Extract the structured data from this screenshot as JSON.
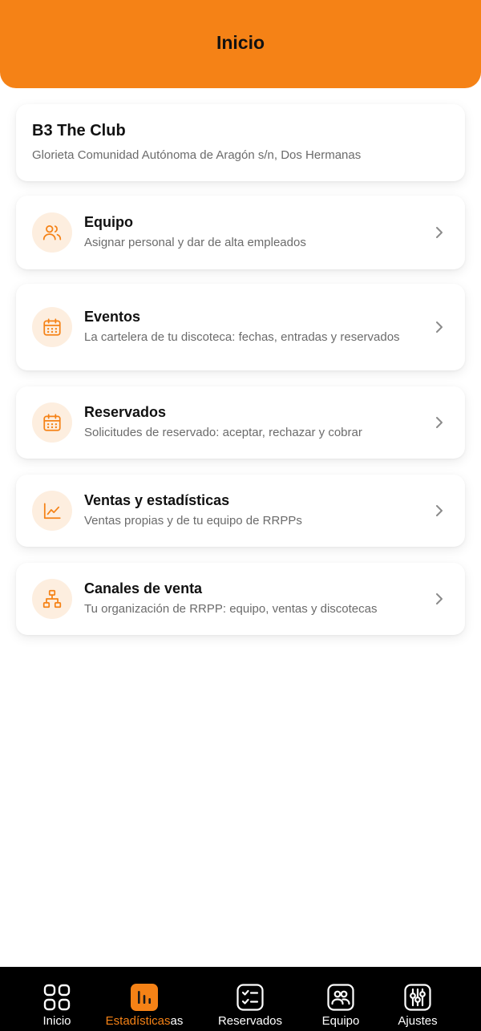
{
  "header": {
    "title": "Inicio"
  },
  "club": {
    "name": "B3 The Club",
    "address": "Glorieta Comunidad Autónoma de Aragón s/n, Dos Hermanas"
  },
  "menu": [
    {
      "title": "Equipo",
      "description": "Asignar personal y dar de alta empleados",
      "icon": "users-icon"
    },
    {
      "title": "Eventos",
      "description": "La cartelera de tu discoteca: fechas, entradas y reservados",
      "icon": "calendar-icon"
    },
    {
      "title": "Reservados",
      "description": "Solicitudes de reservado: aceptar, rechazar y cobrar",
      "icon": "calendar-icon"
    },
    {
      "title": "Ventas y estadísticas",
      "description": "Ventas propias y de tu equipo de RRPPs",
      "icon": "line-chart-icon"
    },
    {
      "title": "Canales de venta",
      "description": "Tu organización de RRPP: equipo, ventas y discotecas",
      "icon": "org-chart-icon"
    }
  ],
  "bottom_nav": [
    {
      "label": "Inicio",
      "icon": "grid-icon",
      "active": false
    },
    {
      "label_highlight": "Estadísticas",
      "label_rest": "as",
      "icon": "bar-chart-icon",
      "active": true
    },
    {
      "label": "Reservados",
      "icon": "checklist-icon",
      "active": false
    },
    {
      "label": "Equipo",
      "icon": "team-icon",
      "active": false
    },
    {
      "label": "Ajustes",
      "icon": "sliders-icon",
      "active": false
    }
  ],
  "colors": {
    "accent": "#F58216",
    "icon_bg": "#FDEEDF",
    "nav_bg": "#000000",
    "muted_text": "#6b6b6b"
  }
}
